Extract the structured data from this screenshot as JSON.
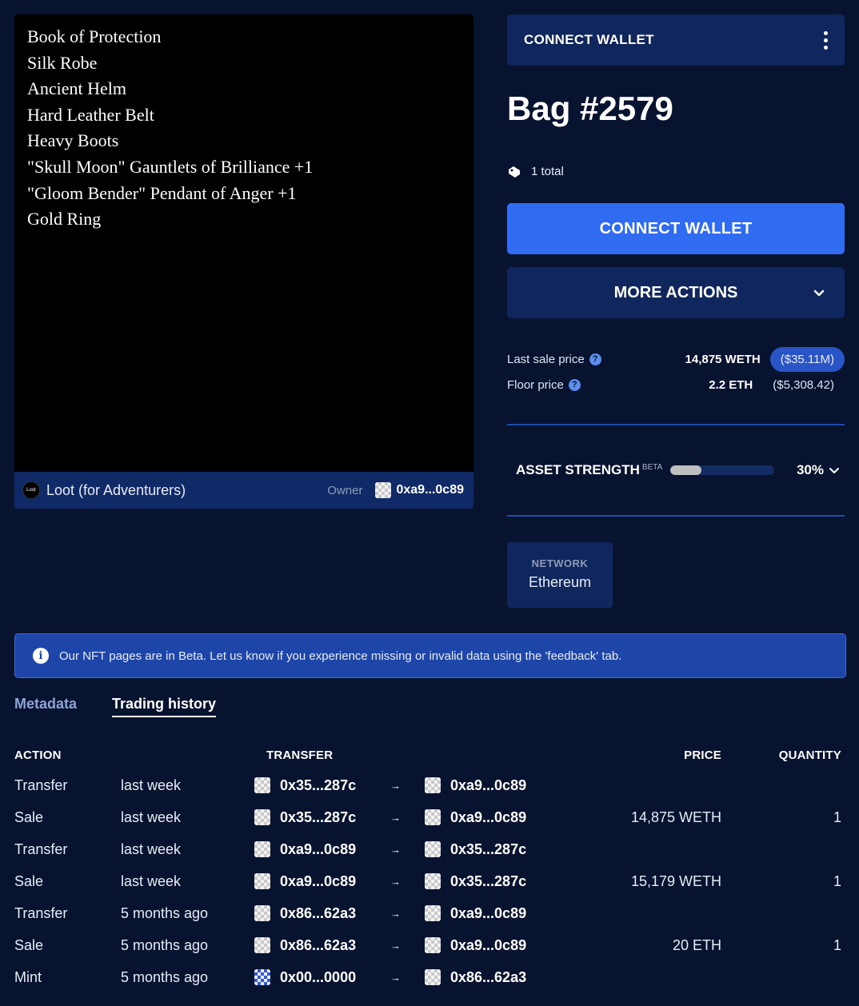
{
  "nft": {
    "items": [
      "Book of Protection",
      "Silk Robe",
      "Ancient Helm",
      "Hard Leather Belt",
      "Heavy Boots",
      "\"Skull Moon\" Gauntlets of Brilliance +1",
      "\"Gloom Bender\" Pendant of Anger +1",
      "Gold Ring"
    ],
    "collection_avatar_text": "Loot",
    "collection_name": "Loot (for Adventurers)",
    "owner_label": "Owner",
    "owner_address": "0xa9...0c89"
  },
  "topbar": {
    "connect_label": "CONNECT WALLET"
  },
  "asset": {
    "title": "Bag #2579",
    "total_text": "1 total"
  },
  "actions": {
    "connect_label": "CONNECT WALLET",
    "more_label": "MORE ACTIONS"
  },
  "prices": {
    "last_sale_label": "Last sale price",
    "last_sale_value": "14,875 WETH",
    "last_sale_usd": "($35.11M)",
    "floor_label": "Floor price",
    "floor_value": "2.2 ETH",
    "floor_usd": "($5,308.42)"
  },
  "strength": {
    "label": "ASSET STRENGTH",
    "beta": "BETA",
    "percent_text": "30%",
    "fraction": 0.3
  },
  "network": {
    "label": "NETWORK",
    "value": "Ethereum"
  },
  "banner": {
    "text": "Our NFT pages are in Beta. Let us know if you experience missing or invalid data using the 'feedback' tab."
  },
  "tabs": {
    "metadata": "Metadata",
    "history": "Trading history"
  },
  "table": {
    "headers": {
      "action": "ACTION",
      "transfer": "TRANSFER",
      "price": "PRICE",
      "quantity": "QUANTITY"
    },
    "rows": [
      {
        "action": "Transfer",
        "when": "last week",
        "from": "0x35...287c",
        "to": "0xa9...0c89",
        "price": "",
        "qty": ""
      },
      {
        "action": "Sale",
        "when": "last week",
        "from": "0x35...287c",
        "to": "0xa9...0c89",
        "price": "14,875 WETH",
        "qty": "1"
      },
      {
        "action": "Transfer",
        "when": "last week",
        "from": "0xa9...0c89",
        "to": "0x35...287c",
        "price": "",
        "qty": ""
      },
      {
        "action": "Sale",
        "when": "last week",
        "from": "0xa9...0c89",
        "to": "0x35...287c",
        "price": "15,179 WETH",
        "qty": "1"
      },
      {
        "action": "Transfer",
        "when": "5 months ago",
        "from": "0x86...62a3",
        "to": "0xa9...0c89",
        "price": "",
        "qty": ""
      },
      {
        "action": "Sale",
        "when": "5 months ago",
        "from": "0x86...62a3",
        "to": "0xa9...0c89",
        "price": "20 ETH",
        "qty": "1"
      },
      {
        "action": "Mint",
        "when": "5 months ago",
        "from": "0x00...0000",
        "to": "0x86...62a3",
        "price": "",
        "qty": ""
      }
    ],
    "arrow_glyph": "→"
  }
}
